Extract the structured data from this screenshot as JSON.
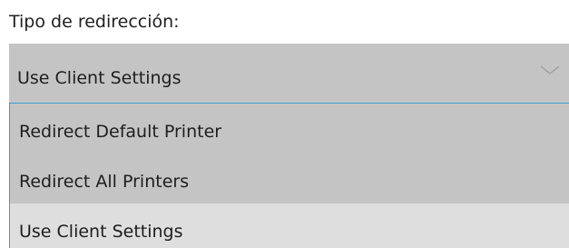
{
  "field_label": "Tipo de redirección:",
  "select": {
    "value": "Use Client Settings",
    "icon": "chevron-down-icon",
    "options": [
      {
        "label": "Redirect Default Printer",
        "selected": false
      },
      {
        "label": "Redirect All Printers",
        "selected": false
      },
      {
        "label": "Use Client Settings",
        "selected": true
      }
    ]
  },
  "colors": {
    "select_background": "#c4c4c4",
    "focus_border": "#3a9bd6",
    "selected_option_background": "#dedede",
    "text": "#1e1e1e"
  }
}
